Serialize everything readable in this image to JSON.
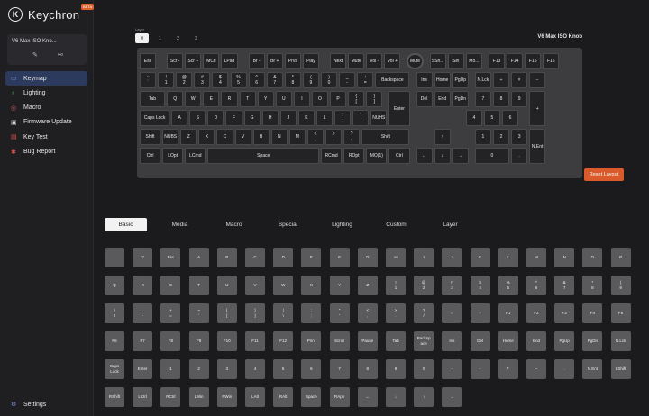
{
  "app": {
    "brand": "Keychron",
    "beta_badge": "BETA"
  },
  "device": {
    "name": "V6 Max ISO Kno..."
  },
  "sidebar": {
    "items": [
      {
        "label": "Keymap",
        "icon": "keyboard-icon",
        "active": true
      },
      {
        "label": "Lighting",
        "icon": "lightbulb-icon"
      },
      {
        "label": "Macro",
        "icon": "macro-icon"
      },
      {
        "label": "Firmware Update",
        "icon": "firmware-icon"
      },
      {
        "label": "Key Test",
        "icon": "key-test-icon"
      },
      {
        "label": "Bug Report",
        "icon": "bug-icon"
      }
    ],
    "settings": {
      "label": "Settings",
      "icon": "gear-icon"
    }
  },
  "layers": {
    "caption": "Layer",
    "options": [
      "0",
      "1",
      "2",
      "3"
    ],
    "selected": "0"
  },
  "keyboard": {
    "title": "V6 Max ISO Knob",
    "rows": [
      [
        [
          "Esc",
          1
        ],
        [
          "",
          0.5
        ],
        [
          "Scr -",
          1
        ],
        [
          "Scr +",
          1
        ],
        [
          "MCtl",
          1
        ],
        [
          "LPad",
          1
        ],
        [
          "",
          0.5
        ],
        [
          "Br -",
          1
        ],
        [
          "Br +",
          1
        ],
        [
          "Prvs",
          1
        ],
        [
          "Play",
          1
        ],
        [
          "",
          0.5
        ],
        [
          "Next",
          1
        ],
        [
          "Mute",
          1
        ],
        [
          "Vol -",
          1
        ],
        [
          "Vol +",
          1
        ],
        [
          "",
          0.25
        ],
        [
          "Mute",
          1,
          "knob"
        ],
        [
          "",
          0.25
        ],
        [
          "SSh...",
          1
        ],
        [
          "Siri",
          1
        ],
        [
          "Mo...",
          1
        ],
        [
          "",
          0.25
        ],
        [
          "F13",
          1
        ],
        [
          "F14",
          1
        ],
        [
          "F15",
          1
        ],
        [
          "F16",
          1
        ]
      ],
      [
        [
          "~\n`",
          1
        ],
        [
          "!\n1",
          1
        ],
        [
          "@\n2",
          1
        ],
        [
          "#\n3",
          1
        ],
        [
          "$\n4",
          1
        ],
        [
          "%\n5",
          1
        ],
        [
          "^\n6",
          1
        ],
        [
          "&\n7",
          1
        ],
        [
          "*\n8",
          1
        ],
        [
          "(\n9",
          1
        ],
        [
          ")\n0",
          1
        ],
        [
          "_\n-",
          1
        ],
        [
          "+\n=",
          1
        ],
        [
          "Backspace",
          2
        ],
        [
          "",
          0.25
        ],
        [
          "Ins",
          1
        ],
        [
          "Home",
          1
        ],
        [
          "PgUp",
          1
        ],
        [
          "",
          0.25
        ],
        [
          "N.Lck",
          1
        ],
        [
          "÷",
          1
        ],
        [
          "×",
          1
        ],
        [
          "−",
          1
        ]
      ],
      [
        [
          "Tab",
          1.5
        ],
        [
          "Q",
          1
        ],
        [
          "W",
          1
        ],
        [
          "E",
          1
        ],
        [
          "R",
          1
        ],
        [
          "T",
          1
        ],
        [
          "Y",
          1
        ],
        [
          "U",
          1
        ],
        [
          "I",
          1
        ],
        [
          "O",
          1
        ],
        [
          "P",
          1
        ],
        [
          "{\n[",
          1
        ],
        [
          "}\n]",
          1
        ],
        [
          "Enter",
          1.5
        ],
        [
          "",
          0.25
        ],
        [
          "Del",
          1
        ],
        [
          "End",
          1
        ],
        [
          "PgDn",
          1
        ],
        [
          "",
          0.25
        ],
        [
          "7",
          1
        ],
        [
          "8",
          1
        ],
        [
          "9",
          1
        ],
        [
          "+",
          1
        ]
      ],
      [
        [
          "Caps Lock",
          1.75
        ],
        [
          "A",
          1
        ],
        [
          "S",
          1
        ],
        [
          "D",
          1
        ],
        [
          "F",
          1
        ],
        [
          "G",
          1
        ],
        [
          "H",
          1
        ],
        [
          "J",
          1
        ],
        [
          "K",
          1
        ],
        [
          "L",
          1
        ],
        [
          ":\n;",
          1
        ],
        [
          "\"\n'",
          1
        ],
        [
          "NUHS",
          1
        ],
        [
          "",
          0.75
        ],
        [
          "",
          0.25
        ],
        [
          "",
          3
        ],
        [
          "",
          0.25
        ],
        [
          "4",
          1
        ],
        [
          "5",
          1
        ],
        [
          "6",
          1
        ]
      ],
      [
        [
          "Shift",
          1.25
        ],
        [
          "NUBS",
          1
        ],
        [
          "Z",
          1
        ],
        [
          "X",
          1
        ],
        [
          "C",
          1
        ],
        [
          "V",
          1
        ],
        [
          "B",
          1
        ],
        [
          "N",
          1
        ],
        [
          "M",
          1
        ],
        [
          "<\n,",
          1
        ],
        [
          ">\n.",
          1
        ],
        [
          "?\n/",
          1
        ],
        [
          "Shift",
          2.75
        ],
        [
          "",
          1.25
        ],
        [
          "↑",
          1
        ],
        [
          "",
          1.25
        ],
        [
          "1",
          1
        ],
        [
          "2",
          1
        ],
        [
          "3",
          1
        ],
        [
          "N.Ent",
          1
        ]
      ],
      [
        [
          "Ctrl",
          1.25
        ],
        [
          "LOpt",
          1.25
        ],
        [
          "LCmd",
          1.25
        ],
        [
          "Space",
          6.25
        ],
        [
          "RCmd",
          1.25
        ],
        [
          "ROpt",
          1.25
        ],
        [
          "MO(1)",
          1.25
        ],
        [
          "Ctrl",
          1.25
        ],
        [
          "",
          0.25
        ],
        [
          "←",
          1
        ],
        [
          "↓",
          1
        ],
        [
          "→",
          1
        ],
        [
          "",
          0.25
        ],
        [
          "0",
          2
        ],
        [
          ".",
          1
        ]
      ]
    ]
  },
  "actions": {
    "reset_label": "Reset Layout"
  },
  "category_tabs": {
    "items": [
      "Basic",
      "Media",
      "Macro",
      "Special",
      "Lighting",
      "Custom",
      "Layer"
    ],
    "selected": "Basic"
  },
  "keycodes": [
    "",
    "▽",
    "Esc",
    "A",
    "B",
    "C",
    "D",
    "E",
    "F",
    "G",
    "H",
    "I",
    "J",
    "K",
    "L",
    "M",
    "N",
    "O",
    "P",
    "Q",
    "R",
    "S",
    "T",
    "U",
    "V",
    "W",
    "X",
    "Y",
    "Z",
    "!\n1",
    "@\n2",
    "#\n3",
    "$\n4",
    "%\n5",
    "^\n6",
    "&\n7",
    "*\n8",
    "(\n9",
    ")\n0",
    "_\n-",
    "+\n=",
    "~\n`",
    "{\n[",
    "}\n]",
    "|\n\\",
    ":\n;",
    "\"\n'",
    "<\n,",
    ">\n.",
    "?\n/",
    "=",
    "÷",
    "F1",
    "F2",
    "F3",
    "F4",
    "F5",
    "F6",
    "F7",
    "F8",
    "F9",
    "F10",
    "F11",
    "F12",
    "Print",
    "Scroll",
    "Pause",
    "Tab",
    "Backsp\nace",
    "Ins",
    "Del",
    "Home",
    "End",
    "PgUp",
    "PgDn",
    "N.Lck",
    "Caps\nLock",
    "Enter",
    "1",
    "2",
    "3",
    "4",
    "5",
    "6",
    "7",
    "8",
    "9",
    "0",
    "+",
    "-",
    "*",
    "−",
    ".",
    "N.Ent",
    "LShift",
    "RShift",
    "LCtrl",
    "RCtrl",
    "LWin",
    "RWin",
    "LAlt",
    "RAlt",
    "Space",
    "RApp",
    "←",
    "↓",
    "↑",
    "→"
  ]
}
